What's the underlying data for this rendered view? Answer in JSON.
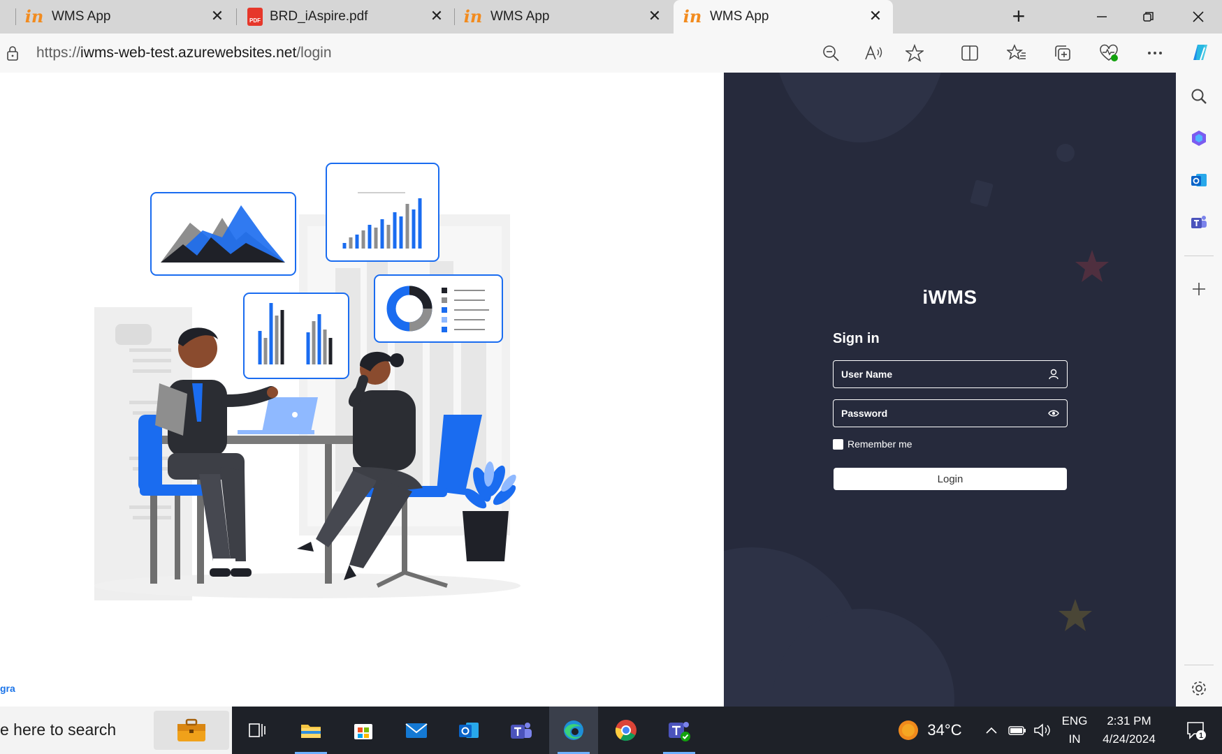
{
  "browser": {
    "tabs": [
      {
        "title": "WMS App",
        "favicon": "in-logo-icon",
        "active": false
      },
      {
        "title": "BRD_iAspire.pdf",
        "favicon": "pdf-icon",
        "active": false
      },
      {
        "title": "WMS App",
        "favicon": "in-logo-icon",
        "active": false
      },
      {
        "title": "WMS App",
        "favicon": "in-logo-icon",
        "active": true
      }
    ],
    "favicon_text": {
      "in": "in",
      "pdf": "PDF"
    },
    "close_glyph": "✕",
    "new_tab_glyph": "+",
    "address": {
      "prefix": "https://",
      "host": "iwms-web-test.azurewebsites.net",
      "path": "/login"
    }
  },
  "login": {
    "brand": "iWMS",
    "heading": "Sign in",
    "username_placeholder": "User Name",
    "password_placeholder": "Password",
    "remember_label": "Remember me",
    "button_label": "Login"
  },
  "page": {
    "footer_link": "gra"
  },
  "taskbar": {
    "search_text": "e here to search",
    "weather_temp": "34°C",
    "language_primary": "ENG",
    "language_secondary": "IN",
    "time": "2:31 PM",
    "date": "4/24/2024",
    "notification_count": "1"
  },
  "colors": {
    "right_panel": "#262a3c",
    "accent_orange": "#f28b1e",
    "chart_blue": "#1a6cf0",
    "taskbar": "#1e2128"
  }
}
